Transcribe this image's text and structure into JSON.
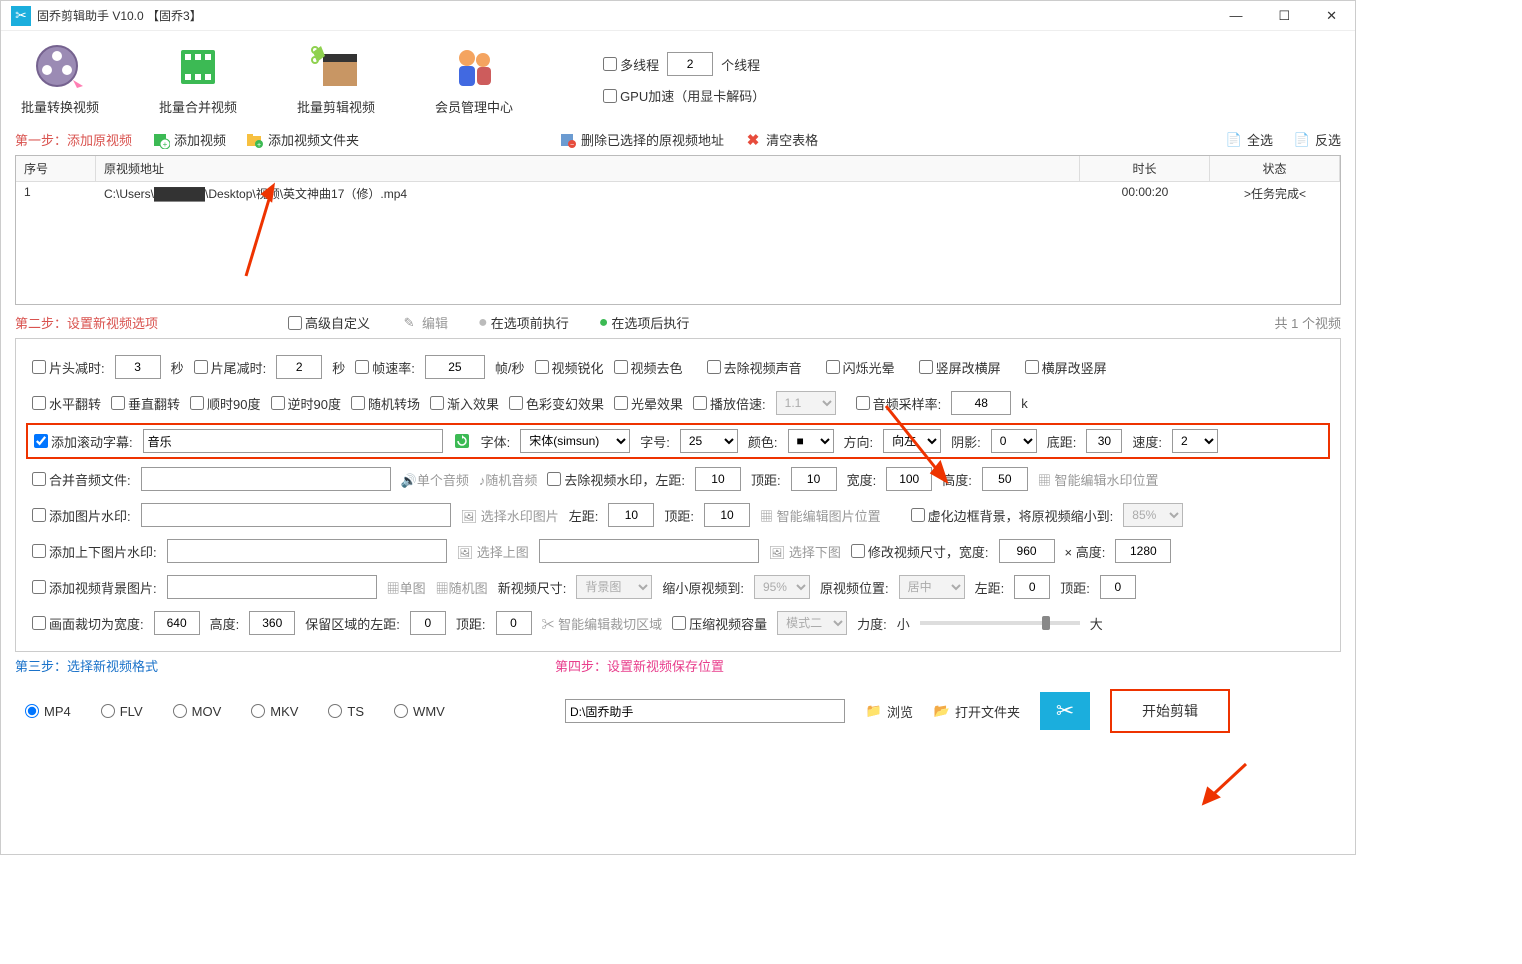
{
  "window": {
    "title": "固乔剪辑助手 V10.0   【固乔3】"
  },
  "toolbar": {
    "items": [
      {
        "label": "批量转换视频"
      },
      {
        "label": "批量合并视频"
      },
      {
        "label": "批量剪辑视频"
      },
      {
        "label": "会员管理中心"
      }
    ],
    "multithread": {
      "label": "多线程",
      "value": "2",
      "suffix": "个线程"
    },
    "gpu": {
      "label": "GPU加速（用显卡解码）"
    }
  },
  "step1": {
    "label": "第一步：添加原视频",
    "add_video": "添加视频",
    "add_folder": "添加视频文件夹",
    "del_selected": "删除已选择的原视频地址",
    "clear_table": "清空表格",
    "select_all": "全选",
    "invert": "反选"
  },
  "table": {
    "headers": {
      "idx": "序号",
      "path": "原视频地址",
      "dur": "时长",
      "stat": "状态"
    },
    "rows": [
      {
        "idx": "1",
        "path": "C:\\Users\\██████\\Desktop\\视频\\英文神曲17（修）.mp4",
        "dur": "00:00:20",
        "stat": ">任务完成<"
      }
    ]
  },
  "step2": {
    "label": "第二步：设置新视频选项",
    "advanced": "高级自定义",
    "edit": "编辑",
    "before": "在选项前执行",
    "after": "在选项后执行",
    "count": "共 1 个视频"
  },
  "opts": {
    "head_cut": "片头减时:",
    "head_val": "3",
    "sec": "秒",
    "tail_cut": "片尾减时:",
    "tail_val": "2",
    "fps": "帧速率:",
    "fps_val": "25",
    "fps_unit": "帧/秒",
    "sharpen": "视频锐化",
    "desaturate": "视频去色",
    "mute": "去除视频声音",
    "flash": "闪烁光晕",
    "v2h": "竖屏改横屏",
    "h2v": "横屏改竖屏",
    "hflip": "水平翻转",
    "vflip": "垂直翻转",
    "cw90": "顺时90度",
    "ccw90": "逆时90度",
    "rand_trans": "随机转场",
    "fade": "渐入效果",
    "color_shift": "色彩变幻效果",
    "halo": "光晕效果",
    "speed": "播放倍速:",
    "speed_val": "1.1",
    "sample_rate": "音频采样率:",
    "sample_val": "48",
    "sample_unit": "k",
    "scroll_sub": "添加滚动字幕:",
    "sub_text": "音乐",
    "font_lbl": "字体:",
    "font_val": "宋体(simsun)",
    "size_lbl": "字号:",
    "size_val": "25",
    "color_lbl": "颜色:",
    "dir_lbl": "方向:",
    "dir_val": "向左",
    "shadow_lbl": "阴影:",
    "shadow_val": "0",
    "bottom_lbl": "底距:",
    "bottom_val": "30",
    "spd_lbl": "速度:",
    "spd_val": "2",
    "merge_audio": "合并音频文件:",
    "single_audio": "单个音频",
    "rand_audio": "随机音频",
    "rm_watermark": "去除视频水印，左距:",
    "wm_left": "10",
    "top_lbl": "顶距:",
    "wm_top": "10",
    "width_lbl": "宽度:",
    "wm_width": "100",
    "height_lbl": "高度:",
    "wm_height": "50",
    "smart_wm": "智能编辑水印位置",
    "img_wm": "添加图片水印:",
    "sel_wm_img": "选择水印图片",
    "img_left_lbl": "左距:",
    "img_left": "10",
    "img_top": "10",
    "smart_img": "智能编辑图片位置",
    "blur_border": "虚化边框背景，将原视频缩小到:",
    "blur_pct": "85%",
    "tb_wm": "添加上下图片水印:",
    "sel_top": "选择上图",
    "sel_bot": "选择下图",
    "resize": "修改视频尺寸，宽度:",
    "rw": "960",
    "rh": "1280",
    "x": "× 高度:",
    "bg_img": "添加视频背景图片:",
    "single_img": "单图",
    "rand_img": "随机图",
    "new_size": "新视频尺寸:",
    "new_size_val": "背景图",
    "shrink_to": "缩小原视频到:",
    "shrink_val": "95%",
    "orig_pos": "原视频位置:",
    "orig_pos_val": "居中",
    "bg_left_lbl": "左距:",
    "bg_left": "0",
    "bg_top": "0",
    "crop_w": "画面裁切为宽度:",
    "crop_w_val": "640",
    "crop_h_lbl": "高度:",
    "crop_h_val": "360",
    "keep_left": "保留区域的左距:",
    "keep_l": "0",
    "keep_top_lbl": "顶距:",
    "keep_t": "0",
    "smart_crop": "智能编辑裁切区域",
    "compress": "压缩视频容量",
    "mode": "模式二",
    "strength": "力度:",
    "small": "小",
    "large": "大"
  },
  "step3": {
    "label": "第三步：选择新视频格式"
  },
  "step4": {
    "label": "第四步：设置新视频保存位置"
  },
  "formats": [
    "MP4",
    "FLV",
    "MOV",
    "MKV",
    "TS",
    "WMV"
  ],
  "output": {
    "path": "D:\\固乔助手",
    "browse": "浏览",
    "open_folder": "打开文件夹",
    "start": "开始剪辑"
  }
}
